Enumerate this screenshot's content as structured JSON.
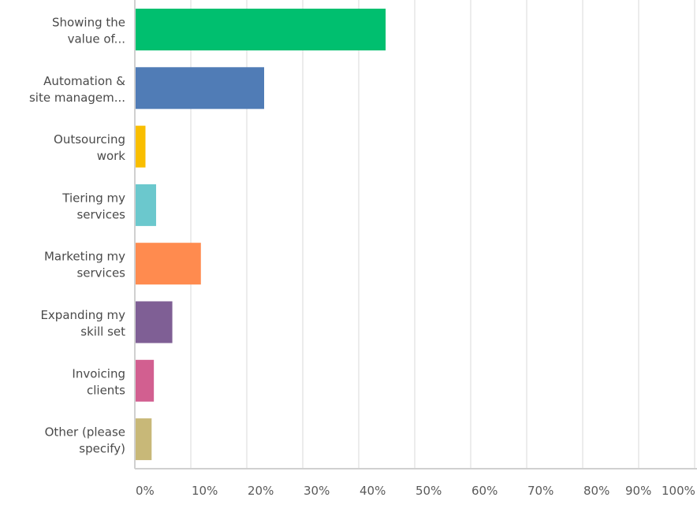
{
  "chart_data": {
    "type": "bar",
    "orientation": "horizontal",
    "title": "",
    "xlabel": "",
    "ylabel": "",
    "xlim": [
      0,
      100
    ],
    "grid": true,
    "categories": [
      [
        "Showing the",
        "value of..."
      ],
      [
        "Automation &",
        "site managem..."
      ],
      [
        "Outsourcing",
        "work"
      ],
      [
        "Tiering my",
        "services"
      ],
      [
        "Marketing my",
        "services"
      ],
      [
        "Expanding my",
        "skill set"
      ],
      [
        "Invoicing",
        "clients"
      ],
      [
        "Other (please",
        "specify)"
      ]
    ],
    "values": [
      44.8,
      23.1,
      1.9,
      3.8,
      11.8,
      6.7,
      3.4,
      3.0
    ],
    "colors": [
      "#00bf6f",
      "#507cb6",
      "#f9be00",
      "#6bc8cd",
      "#ff8b4f",
      "#7f5f95",
      "#d25f90",
      "#c8b878"
    ],
    "tick_labels": [
      "0%",
      "10%",
      "20%",
      "30%",
      "40%",
      "50%",
      "60%",
      "70%",
      "80%",
      "90%",
      "100%"
    ]
  }
}
